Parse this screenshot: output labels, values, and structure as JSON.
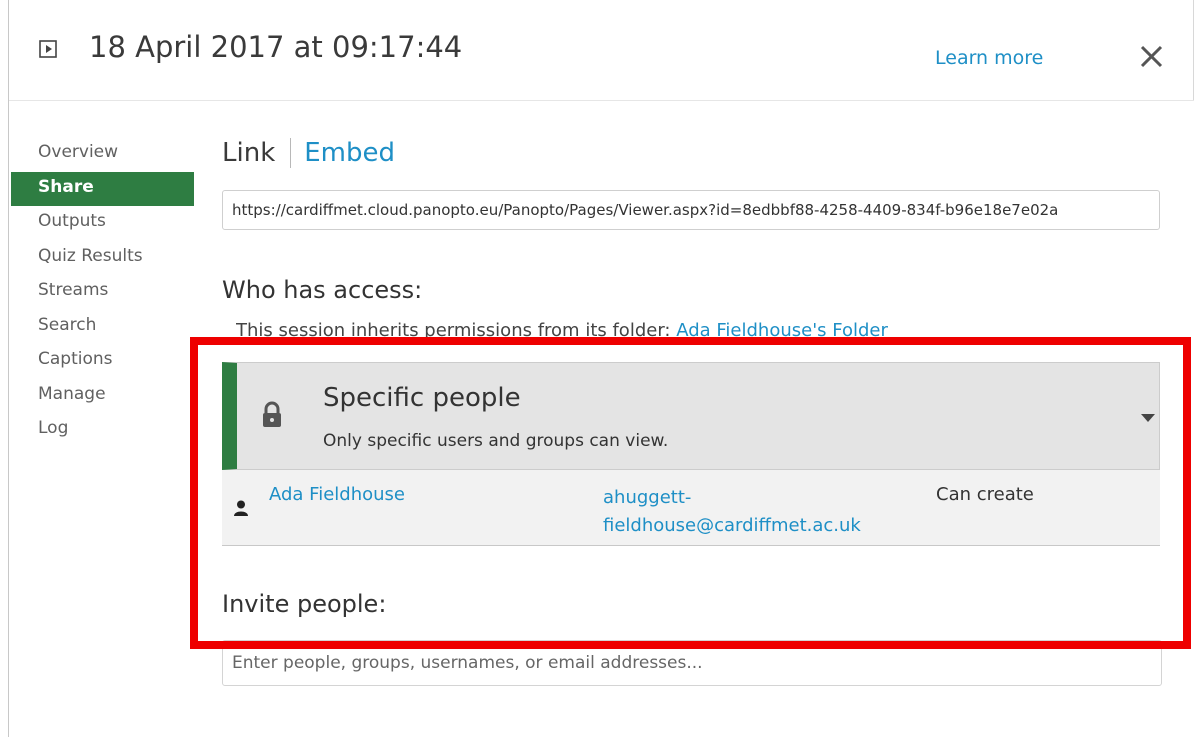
{
  "header": {
    "title": "18 April 2017 at 09:17:44",
    "learn_more": "Learn more",
    "play_icon": "play-icon",
    "close_icon": "close-icon"
  },
  "sidebar": {
    "items": [
      {
        "label": "Overview"
      },
      {
        "label": "Share",
        "active": true
      },
      {
        "label": "Outputs"
      },
      {
        "label": "Quiz Results"
      },
      {
        "label": "Streams"
      },
      {
        "label": "Search"
      },
      {
        "label": "Captions"
      },
      {
        "label": "Manage"
      },
      {
        "label": "Log"
      }
    ]
  },
  "share": {
    "tabs": {
      "link": "Link",
      "embed": "Embed"
    },
    "link_url": "https://cardiffmet.cloud.panopto.eu/Panopto/Pages/Viewer.aspx?id=8edbbf88-4258-4409-834f-b96e18e7e02a",
    "access": {
      "heading": "Who has access:",
      "inherit_text": "This session inherits permissions from its folder: ",
      "inherit_folder": "Ada Fieldhouse's Folder",
      "level_title": "Specific people",
      "level_desc": "Only specific users and groups can view.",
      "lock_icon": "lock-icon",
      "caret_icon": "caret-down-icon"
    },
    "users": [
      {
        "name": "Ada Fieldhouse",
        "email_line1": "ahuggett-",
        "email_line2": "fieldhouse@cardiffmet.ac.uk",
        "role": "Can create"
      }
    ],
    "invite": {
      "heading": "Invite people:",
      "placeholder": "Enter people, groups, usernames, or email addresses..."
    }
  },
  "colors": {
    "accent_green": "#2e7d42",
    "link_blue": "#1e8fc6",
    "highlight_red": "#ee0000"
  }
}
